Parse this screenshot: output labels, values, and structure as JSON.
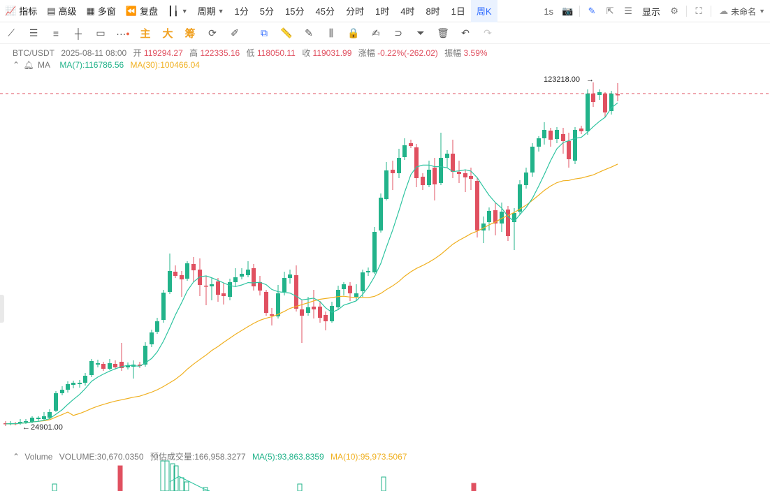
{
  "toolbar": {
    "indicators": "指标",
    "advanced": "高级",
    "multi_window": "多窗",
    "replay": "复盘",
    "period_label": "周期",
    "periods": [
      "1分",
      "5分",
      "15分",
      "45分",
      "分时",
      "1时",
      "4时",
      "8时",
      "1日",
      "周K"
    ],
    "active_period": "周K",
    "refresh": "1s",
    "display": "显示",
    "workspace": "未命名"
  },
  "drawing_tools": {
    "main": "主",
    "big": "大",
    "chips": "筹"
  },
  "legend": {
    "symbol": "BTC/USDT",
    "date": "2025-08-11 08:00",
    "open_label": "开",
    "open": "119294.27",
    "high_label": "高",
    "high": "122335.16",
    "low_label": "低",
    "low": "118050.11",
    "close_label": "收",
    "close": "119031.99",
    "change_label": "涨幅",
    "change": "-0.22%(-262.02)",
    "amplitude_label": "振幅",
    "amplitude": "3.59%",
    "ma_name": "MA",
    "ma7": "MA(7):116786.56",
    "ma30": "MA(30):100466.04"
  },
  "price_markers": {
    "high_marker": "123218.00",
    "low_marker": "24901.00"
  },
  "volume_legend": {
    "name": "Volume",
    "volume": "VOLUME:30,670.0350",
    "estimate": "预估成交量:166,958.3277",
    "ma5": "MA(5):93,863.8359",
    "ma10": "MA(10):95,973.5067"
  },
  "colors": {
    "up": "#22b38a",
    "down": "#e05060",
    "ma7": "#2ec4a0",
    "ma30": "#f0b020",
    "accent": "#2f6bff"
  }
}
